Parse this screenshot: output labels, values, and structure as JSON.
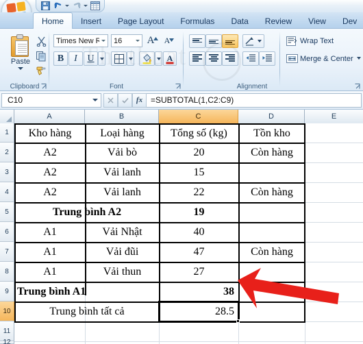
{
  "app": {
    "office_button": "office-orb",
    "quick_access": [
      {
        "name": "save-icon",
        "glyph": "💾"
      },
      {
        "name": "undo-icon",
        "glyph": "↶"
      },
      {
        "name": "redo-icon",
        "glyph": "↷"
      },
      {
        "name": "table-icon",
        "glyph": "▦"
      },
      {
        "name": "customize-qat-icon",
        "glyph": "≡"
      }
    ]
  },
  "ribbon": {
    "tabs": [
      {
        "label": "Home",
        "active": true
      },
      {
        "label": "Insert",
        "active": false
      },
      {
        "label": "Page Layout",
        "active": false
      },
      {
        "label": "Formulas",
        "active": false
      },
      {
        "label": "Data",
        "active": false
      },
      {
        "label": "Review",
        "active": false
      },
      {
        "label": "View",
        "active": false
      },
      {
        "label": "Dev",
        "active": false
      }
    ],
    "clipboard": {
      "group_label": "Clipboard",
      "paste_label": "Paste",
      "cut_icon": "✂",
      "copy_icon": "⧉",
      "format_painter_icon": "🖌"
    },
    "font": {
      "group_label": "Font",
      "font_name": "Times New Rom",
      "font_size": "16",
      "grow_font": "A",
      "shrink_font": "A",
      "bold": "B",
      "italic": "I",
      "underline": "U",
      "borders_icon": "⊞",
      "fill_color": "△",
      "font_color": "A"
    },
    "alignment": {
      "group_label": "Alignment",
      "wrap_text": "Wrap Text",
      "merge_center": "Merge & Center",
      "orientation_icon": "➦",
      "indent_decrease": "⇤",
      "indent_increase": "⇥"
    }
  },
  "formula_bar": {
    "name_box": "C10",
    "cancel_icon": "✕",
    "enter_icon": "✓",
    "function_icon": "fx",
    "formula": "=SUBTOTAL(1,C2:C9)"
  },
  "grid": {
    "columns": [
      "A",
      "B",
      "C",
      "D",
      "E"
    ],
    "selected_column": "C",
    "selected_row": "10",
    "selected_cell": "C10",
    "rows": [
      "1",
      "2",
      "3",
      "4",
      "5",
      "6",
      "7",
      "8",
      "9",
      "10",
      "11",
      "12"
    ],
    "cells": [
      {
        "row": 1,
        "A": "Kho hàng",
        "B": "Loại hàng",
        "C": "Tổng số (kg)",
        "D": "Tồn kho"
      },
      {
        "row": 2,
        "A": "A2",
        "B": "Vải bò",
        "C": "20",
        "D": "Còn hàng"
      },
      {
        "row": 3,
        "A": "A2",
        "B": "Vải lanh",
        "C": "15",
        "D": ""
      },
      {
        "row": 4,
        "A": "A2",
        "B": "Vải lanh",
        "C": "22",
        "D": "Còn hàng"
      },
      {
        "row": 5,
        "A": "Trung bình A2",
        "B": "",
        "C": "19",
        "D": ""
      },
      {
        "row": 6,
        "A": "A1",
        "B": "Vải Nhật",
        "C": "40",
        "D": ""
      },
      {
        "row": 7,
        "A": "A1",
        "B": "Vải đũi",
        "C": "47",
        "D": "Còn hàng"
      },
      {
        "row": 8,
        "A": "A1",
        "B": "Vải thun",
        "C": "27",
        "D": ""
      },
      {
        "row": 9,
        "A": "Trung bình A1",
        "B": "",
        "C": "38",
        "D": ""
      },
      {
        "row": 10,
        "A": "Trung bình tất cả",
        "B": "",
        "C": "28.5",
        "D": ""
      },
      {
        "row": 11,
        "A": "",
        "B": "",
        "C": "",
        "D": ""
      },
      {
        "row": 12,
        "A": "",
        "B": "",
        "C": "",
        "D": ""
      }
    ]
  },
  "annotation": {
    "arrow_color": "#e8201a",
    "arrow_target": "C10",
    "arrow_direction": "left"
  },
  "watermark": {
    "text": "Thuthuat"
  },
  "colors": {
    "selection_header": "#f5b65b",
    "ribbon_blue": "#b5d1ec",
    "grid_line": "#d4dce4"
  }
}
